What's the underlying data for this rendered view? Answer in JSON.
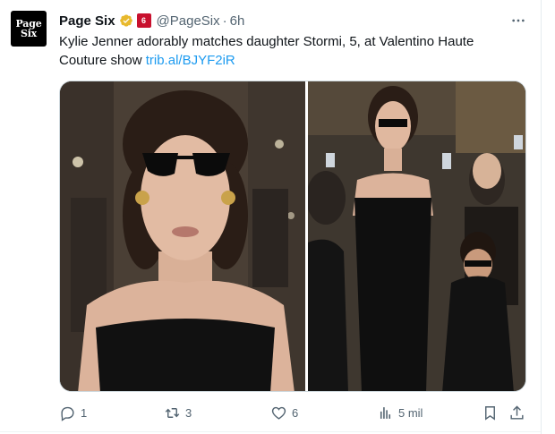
{
  "account": {
    "display_name": "Page Six",
    "handle": "@PageSix",
    "separator": "·",
    "time": "6h",
    "avatar_line1": "Page",
    "avatar_line2": "Six",
    "affiliate_badge": "6"
  },
  "tweet": {
    "text": "Kylie Jenner adorably matches daughter Stormi, 5, at Valentino Haute Couture show ",
    "link": "trib.al/BJYF2iR"
  },
  "media": {
    "photos": [
      "photo-kylie-closeup",
      "photo-kylie-stormi-full"
    ]
  },
  "actions": {
    "replies": "1",
    "reposts": "3",
    "likes": "6",
    "views": "5 mil"
  },
  "icons": {
    "verified": "verified-badge-icon",
    "more": "more-dots-icon",
    "reply": "reply-icon",
    "repost": "repost-icon",
    "like": "heart-icon",
    "views": "views-bar-icon",
    "bookmark": "bookmark-icon",
    "share": "share-icon"
  },
  "colors": {
    "link": "#1d9bf0",
    "verified_gold": "#e8b92d",
    "muted": "#536471",
    "affiliate_red": "#c8102e"
  }
}
